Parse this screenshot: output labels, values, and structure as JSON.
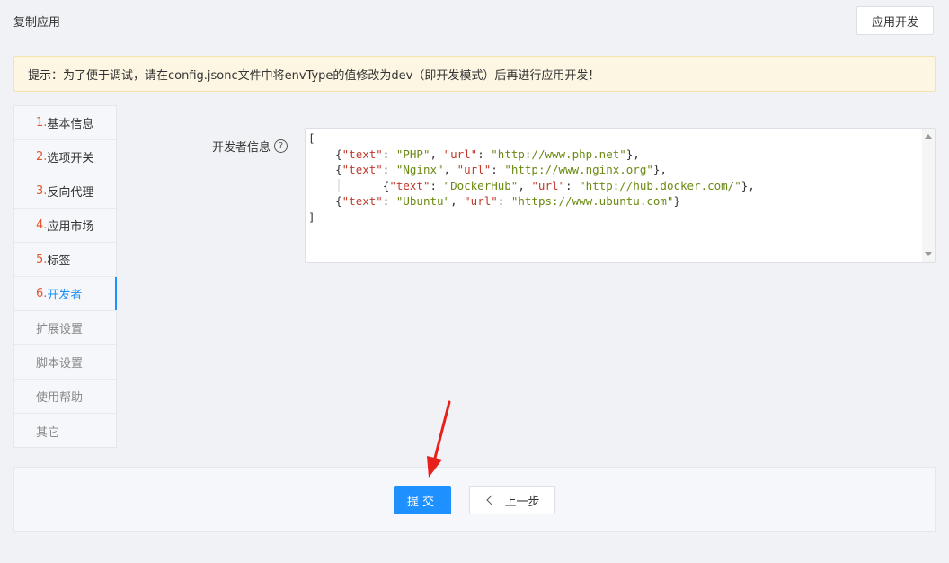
{
  "header": {
    "title": "复制应用",
    "dev_button_label": "应用开发"
  },
  "notice": {
    "text": "提示：为了便于调试，请在config.jsonc文件中将envType的值修改为dev（即开发模式）后再进行应用开发！"
  },
  "sidebar": {
    "items": [
      {
        "num": "1.",
        "label": "基本信息"
      },
      {
        "num": "2.",
        "label": "选项开关"
      },
      {
        "num": "3.",
        "label": "反向代理"
      },
      {
        "num": "4.",
        "label": "应用市场"
      },
      {
        "num": "5.",
        "label": "标签"
      },
      {
        "num": "6.",
        "label": "开发者"
      },
      {
        "num": "",
        "label": "扩展设置"
      },
      {
        "num": "",
        "label": "脚本设置"
      },
      {
        "num": "",
        "label": "使用帮助"
      },
      {
        "num": "",
        "label": "其它"
      }
    ],
    "active_index": 5
  },
  "form": {
    "developer_label": "开发者信息",
    "help_glyph": "?",
    "developer_json": [
      {
        "text": "PHP",
        "url": "http://www.php.net"
      },
      {
        "text": "Nginx",
        "url": "http://www.nginx.org"
      },
      {
        "text": "DockerHub",
        "url": "http://hub.docker.com/"
      },
      {
        "text": "Ubuntu",
        "url": "https://www.ubuntu.com"
      }
    ]
  },
  "footer": {
    "submit_label": "提交",
    "prev_label": "上一步"
  },
  "colors": {
    "primary": "#1e90ff",
    "step_number": "#e4572e",
    "notice_bg": "#fdf6e3",
    "annotation_arrow": "#e8201c"
  }
}
